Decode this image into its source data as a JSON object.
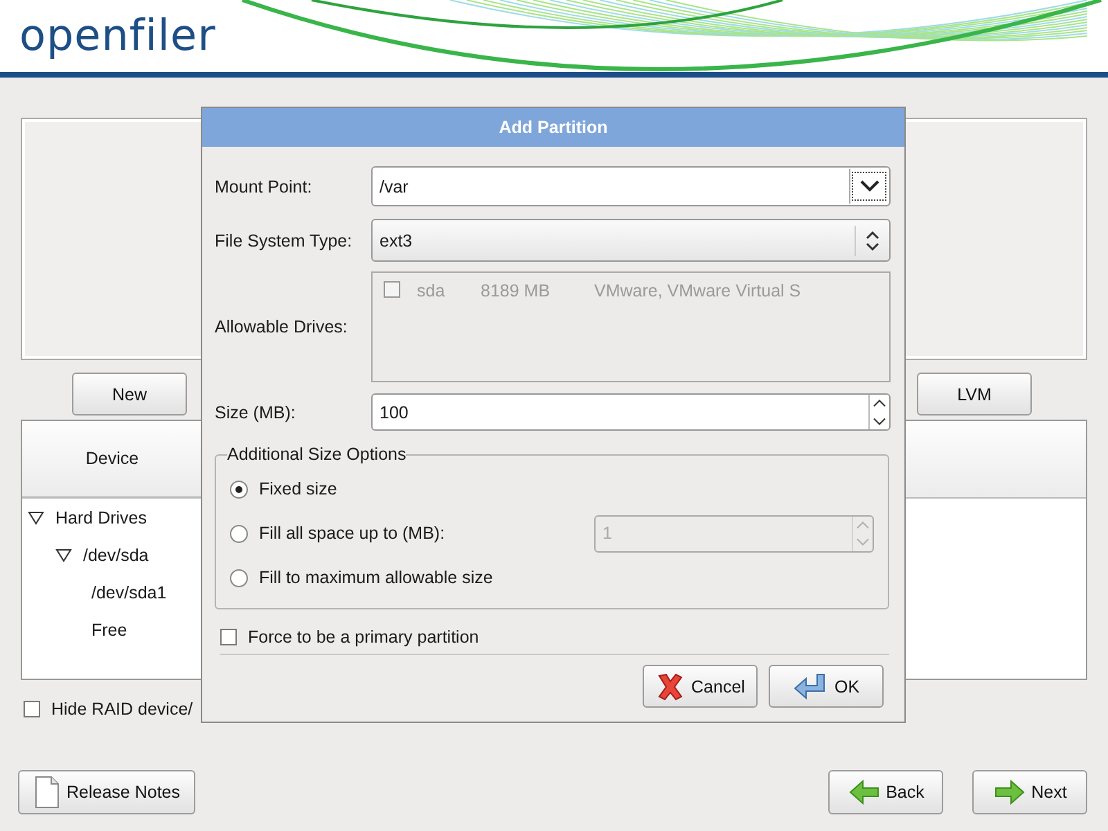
{
  "header": {
    "logo": "openfiler"
  },
  "partition_buttons": [
    {
      "label": "New"
    },
    {
      "label": "LVM"
    }
  ],
  "device_table": {
    "columns": [
      "Device"
    ],
    "tree": [
      {
        "label": "Hard Drives",
        "expanded": true,
        "children": [
          {
            "label": "/dev/sda",
            "expanded": true,
            "children": [
              {
                "label": "/dev/sda1"
              },
              {
                "label": "Free"
              }
            ]
          }
        ]
      }
    ]
  },
  "hide_raid": {
    "label": "Hide RAID device/",
    "checked": false
  },
  "nav_buttons": [
    {
      "label": "Release Notes",
      "kind": "notes"
    },
    {
      "label": "Back",
      "kind": "back"
    },
    {
      "label": "Next",
      "kind": "next"
    }
  ],
  "dialog": {
    "title": "Add Partition",
    "mount_point": {
      "label": "Mount Point:",
      "value": "/var"
    },
    "fs_type": {
      "label": "File System Type:",
      "value": "ext3"
    },
    "drives": {
      "label": "Allowable Drives:",
      "items": [
        {
          "name": "sda",
          "size": "8189 MB",
          "model": "VMware, VMware Virtual S",
          "checked": false,
          "disabled": true
        }
      ]
    },
    "size": {
      "label": "Size (MB):",
      "value": "100"
    },
    "size_options": {
      "title": "Additional Size Options",
      "options": [
        {
          "label": "Fixed size",
          "selected": true
        },
        {
          "label": "Fill all space up to (MB):",
          "selected": false,
          "value": "1",
          "disabled": true
        },
        {
          "label": "Fill to maximum allowable size",
          "selected": false
        }
      ]
    },
    "primary": {
      "label": "Force to be a primary partition",
      "checked": false
    },
    "buttons": [
      {
        "label": "Cancel",
        "kind": "cancel"
      },
      {
        "label": "OK",
        "kind": "ok"
      }
    ]
  }
}
